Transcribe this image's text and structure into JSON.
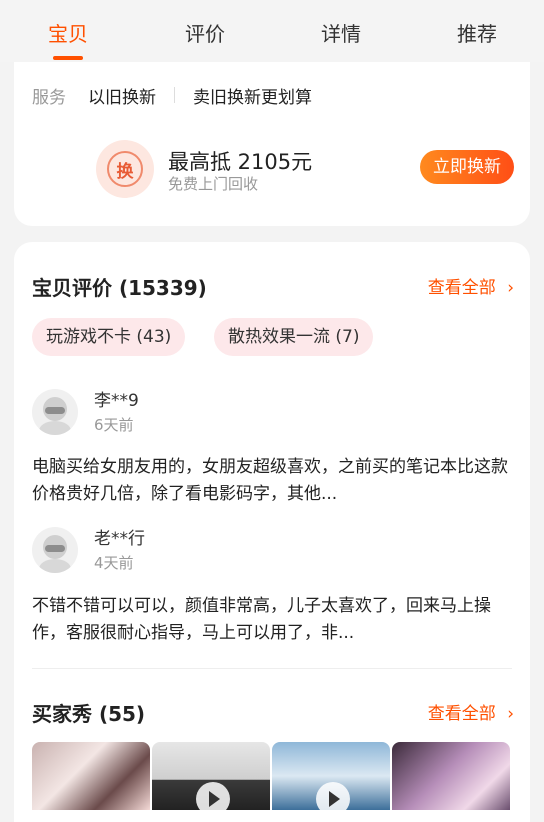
{
  "tabs": [
    {
      "label": "宝贝",
      "active": true
    },
    {
      "label": "评价",
      "active": false
    },
    {
      "label": "详情",
      "active": false
    },
    {
      "label": "推荐",
      "active": false
    }
  ],
  "service": {
    "label": "服务",
    "items": [
      "以旧换新",
      "卖旧换新更划算"
    ]
  },
  "trade_in": {
    "icon_char": "换",
    "title": "最高抵 2105元",
    "subtitle": "免费上门回收",
    "button": "立即换新"
  },
  "reviews": {
    "title": "宝贝评价 (15339)",
    "see_all": "查看全部",
    "tags": [
      "玩游戏不卡 (43)",
      "散热效果一流 (7)"
    ],
    "items": [
      {
        "user": "李**9",
        "time": "6天前",
        "text": "电脑买给女朋友用的，女朋友超级喜欢，之前买的笔记本比这款价格贵好几倍，除了看电影码字，其他..."
      },
      {
        "user": "老**行",
        "time": "4天前",
        "text": "不错不错可以可以，颜值非常高，儿子太喜欢了，回来马上操作，客服很耐心指导，马上可以用了，非..."
      }
    ]
  },
  "buyer_show": {
    "title": "买家秀 (55)",
    "see_all": "查看全部"
  },
  "colors": {
    "accent": "#ff5000",
    "tag_bg": "#fde8ea"
  }
}
